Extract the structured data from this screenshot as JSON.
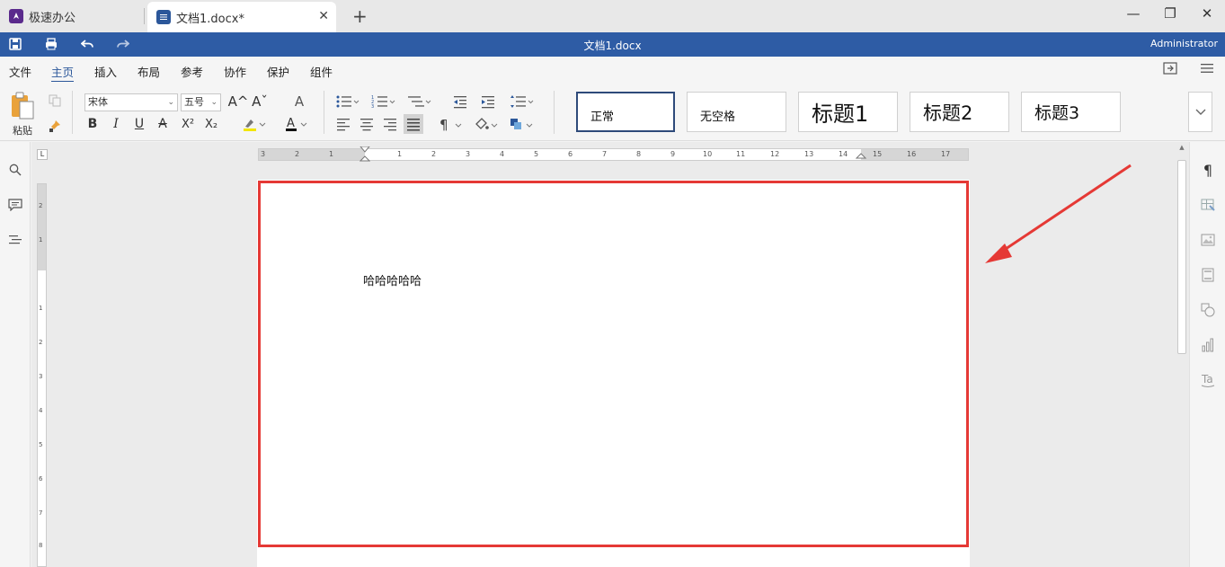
{
  "tabs": {
    "home_label": "极速办公",
    "doc_label": "文档1.docx*",
    "close_glyph": "✕",
    "new_glyph": "+"
  },
  "window": {
    "minimize": "—",
    "restore": "❐",
    "close": "✕"
  },
  "appbar": {
    "title": "文档1.docx",
    "user": "Administrator"
  },
  "menu": {
    "items": [
      "文件",
      "主页",
      "插入",
      "布局",
      "参考",
      "协作",
      "保护",
      "组件"
    ],
    "active": "主页"
  },
  "ribbon": {
    "paste_label": "粘贴",
    "font_name": "宋体",
    "font_size": "五号",
    "bold": "B",
    "italic": "I",
    "underline": "U",
    "strike": "A",
    "superscript": "X²",
    "subscript": "X₂",
    "grow_font": "A^",
    "shrink_font": "Aˇ",
    "clear_format": "A",
    "font_color": "A",
    "paragraph_mark": "¶"
  },
  "styles": [
    {
      "label": "正常",
      "size": 13
    },
    {
      "label": "无空格",
      "size": 13
    },
    {
      "label": "标题1",
      "size": 24
    },
    {
      "label": "标题2",
      "size": 21
    },
    {
      "label": "标题3",
      "size": 19
    }
  ],
  "ruler": {
    "corner": "L",
    "h_ticks": [
      "3",
      "2",
      "1",
      "1",
      "2",
      "3",
      "4",
      "5",
      "6",
      "7",
      "8",
      "9",
      "10",
      "11",
      "12",
      "13",
      "14",
      "15",
      "16",
      "17"
    ],
    "v_ticks": [
      "2",
      "1",
      "1",
      "2",
      "3",
      "4",
      "5",
      "6",
      "7",
      "8"
    ]
  },
  "document": {
    "text": "哈哈哈哈哈"
  },
  "colors": {
    "app_blue": "#2e5ca5",
    "highlight_red": "#e53935",
    "arrow_red": "#e53935"
  }
}
